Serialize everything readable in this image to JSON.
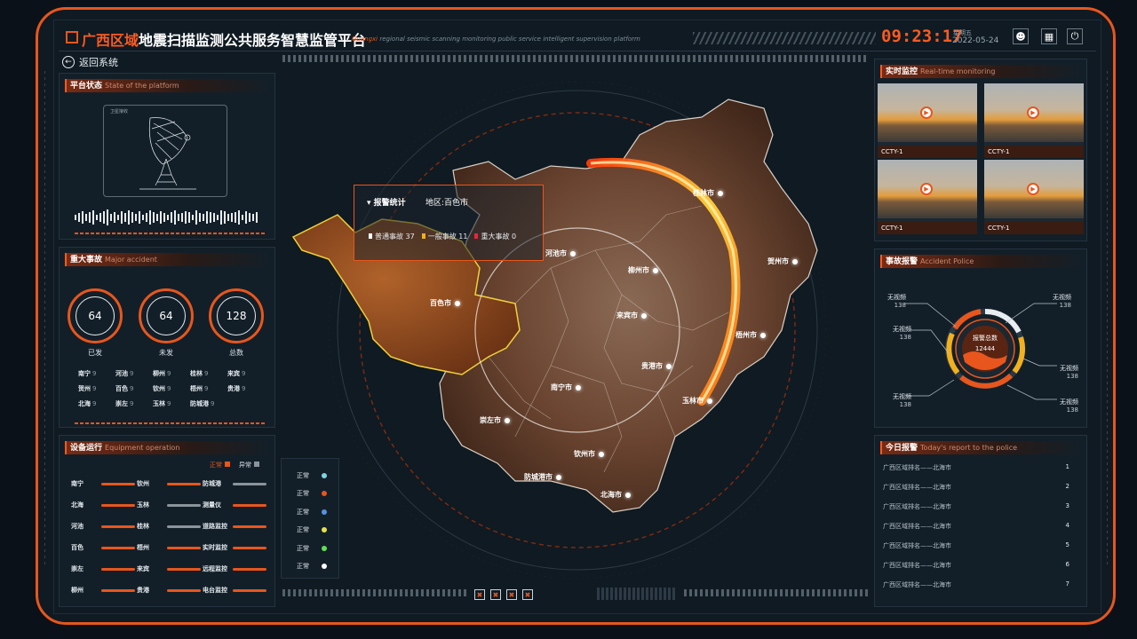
{
  "header": {
    "title_highlight": "广西区域",
    "title_rest": "地震扫描监测公共服务智慧监管平台",
    "subtitle_highlight": "Guangxi",
    "subtitle_rest": " regional seismic scanning monitoring public service intelligent supervision platform",
    "time": "09:23:17",
    "weekday": "星期五",
    "date": "2022-05-24",
    "icons": [
      "user-icon",
      "image-icon",
      "power-icon"
    ]
  },
  "back_label": "返回系统",
  "platform_panel": {
    "title": "平台状态",
    "title_en": "State of the platform",
    "dish_caption": "卫星接收"
  },
  "major_panel": {
    "title": "重大事故",
    "title_en": "Major accident",
    "rings": [
      {
        "value": "64",
        "label": "已发"
      },
      {
        "value": "64",
        "label": "未发"
      },
      {
        "value": "128",
        "label": "总数"
      }
    ],
    "cities": [
      {
        "name": "南宁",
        "n": "9"
      },
      {
        "name": "河池",
        "n": "9"
      },
      {
        "name": "柳州",
        "n": "9"
      },
      {
        "name": "桂林",
        "n": "9"
      },
      {
        "name": "来宾",
        "n": "9"
      },
      {
        "name": "贺州",
        "n": "9"
      },
      {
        "name": "百色",
        "n": "9"
      },
      {
        "name": "钦州",
        "n": "9"
      },
      {
        "name": "梧州",
        "n": "9"
      },
      {
        "name": "贵港",
        "n": "9"
      },
      {
        "name": "北海",
        "n": "9"
      },
      {
        "name": "崇左",
        "n": "9"
      },
      {
        "name": "玉林",
        "n": "9"
      },
      {
        "name": "防城港",
        "n": "9"
      }
    ]
  },
  "equipment_panel": {
    "title": "设备运行",
    "title_en": "Equipment operation",
    "normal": "正常",
    "abnormal": "异常",
    "items": [
      {
        "name": "南宁",
        "ok": true
      },
      {
        "name": "钦州",
        "ok": true
      },
      {
        "name": "防城港",
        "ok": false
      },
      {
        "name": "北海",
        "ok": true
      },
      {
        "name": "玉林",
        "ok": false
      },
      {
        "name": "测量仪",
        "ok": true
      },
      {
        "name": "河池",
        "ok": true
      },
      {
        "name": "桂林",
        "ok": false
      },
      {
        "name": "道路监控",
        "ok": true
      },
      {
        "name": "百色",
        "ok": true
      },
      {
        "name": "梧州",
        "ok": true
      },
      {
        "name": "实时监控",
        "ok": true
      },
      {
        "name": "崇左",
        "ok": true
      },
      {
        "name": "来宾",
        "ok": true
      },
      {
        "name": "远程监控",
        "ok": true
      },
      {
        "name": "柳州",
        "ok": true
      },
      {
        "name": "贵港",
        "ok": true
      },
      {
        "name": "电台监控",
        "ok": true
      }
    ]
  },
  "status_legend": [
    {
      "label": "正常",
      "color": "#7fd3e0"
    },
    {
      "label": "正常",
      "color": "#e8561d"
    },
    {
      "label": "正常",
      "color": "#5a8fe0"
    },
    {
      "label": "正常",
      "color": "#e8e04a"
    },
    {
      "label": "正常",
      "color": "#5fe05a"
    },
    {
      "label": "正常",
      "color": "#ffffff"
    }
  ],
  "map": {
    "cities": [
      "桂林市",
      "河池市",
      "柳州市",
      "贺州市",
      "百色市",
      "来宾市",
      "梧州市",
      "贵港市",
      "南宁市",
      "玉林市",
      "崇左市",
      "钦州市",
      "防城港市",
      "北海市"
    ]
  },
  "popup": {
    "title": "报警统计",
    "region": "地区:百色市",
    "stats": [
      {
        "label": "普通事故",
        "value": "37",
        "color": "#ffffff"
      },
      {
        "label": "一般事故",
        "value": "11",
        "color": "#f2b01e"
      },
      {
        "label": "重大事故",
        "value": "0",
        "color": "#e8263a"
      }
    ]
  },
  "monitor_panel": {
    "title": "实时监控",
    "title_en": "Real-time monitoring",
    "cams": [
      "CCTY-1",
      "CCTY-1",
      "CCTY-1",
      "CCTY-1"
    ]
  },
  "alarm_panel": {
    "title": "事故报警",
    "title_en": "Accident Police",
    "center_label": "报警总数",
    "center_value": "12444",
    "labels": [
      {
        "name": "无视频",
        "value": "138"
      },
      {
        "name": "无视频",
        "value": "138"
      },
      {
        "name": "无视频",
        "value": "138"
      },
      {
        "name": "无视频",
        "value": "138"
      },
      {
        "name": "无视频",
        "value": "138"
      },
      {
        "name": "无视频",
        "value": "138"
      }
    ]
  },
  "report_panel": {
    "title": "今日报警",
    "title_en": "Today's report to the police",
    "rows": [
      {
        "text": "广西区域排名——北海市",
        "n": "1"
      },
      {
        "text": "广西区域排名——北海市",
        "n": "2"
      },
      {
        "text": "广西区域排名——北海市",
        "n": "3"
      },
      {
        "text": "广西区域排名——北海市",
        "n": "4"
      },
      {
        "text": "广西区域排名——北海市",
        "n": "5"
      },
      {
        "text": "广西区域排名——北海市",
        "n": "6"
      },
      {
        "text": "广西区域排名——北海市",
        "n": "7"
      }
    ]
  },
  "colors": {
    "accent": "#e8561d",
    "bg": "#0f1a22",
    "panel": "#131f28"
  }
}
